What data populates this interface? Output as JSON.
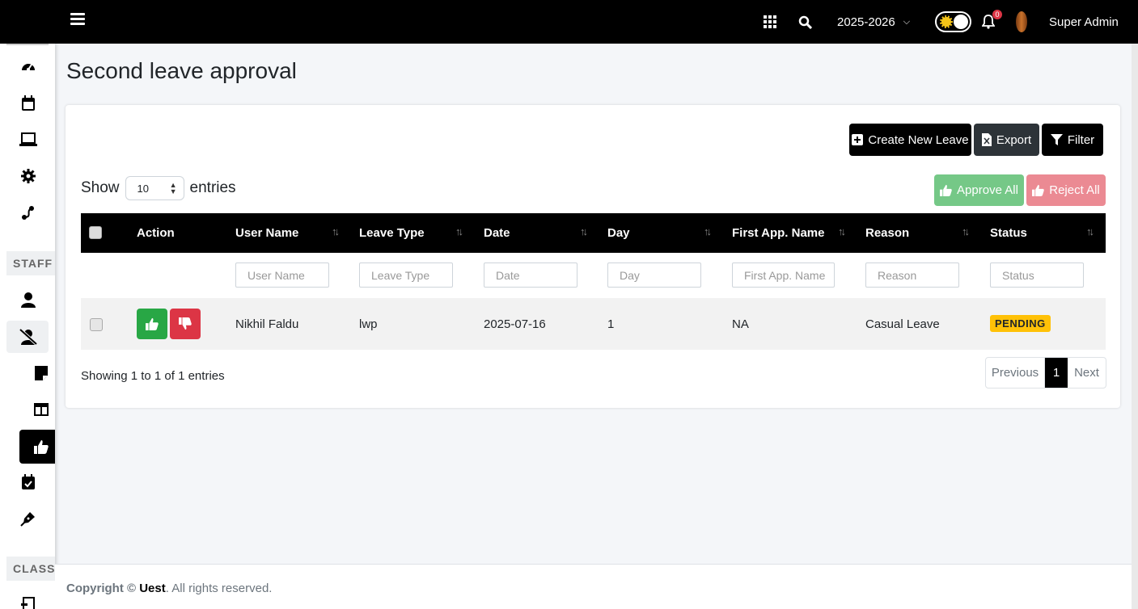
{
  "topbar": {
    "academic_year": "2025-2026",
    "notification_count": "0",
    "user_name": "Super Admin"
  },
  "sidebar": {
    "sections": [
      "STAFF",
      "CLASSWORK"
    ]
  },
  "page": {
    "title": "Second leave approval"
  },
  "toolbar": {
    "create_label": "Create New Leave",
    "export_label": "Export",
    "filter_label": "Filter",
    "approve_all_label": "Approve All",
    "reject_all_label": "Reject All"
  },
  "length": {
    "show": "Show",
    "value": "10",
    "entries": "entries"
  },
  "table": {
    "columns": [
      "Action",
      "User Name",
      "Leave Type",
      "Date",
      "Day",
      "First App. Name",
      "Reason",
      "Status"
    ],
    "filters": [
      "User Name",
      "Leave Type",
      "Date",
      "Day",
      "First App. Name",
      "Reason",
      "Status"
    ],
    "rows": [
      {
        "user_name": "Nikhil Faldu",
        "leave_type": "lwp",
        "date": "2025-07-16",
        "day": "1",
        "first_app_name": "NA",
        "reason": "Casual Leave",
        "status": "PENDING"
      }
    ]
  },
  "info": "Showing 1 to 1 of 1 entries",
  "pagination": {
    "previous": "Previous",
    "current": "1",
    "next": "Next"
  },
  "footer": {
    "prefix": "Copyright ©",
    "brand": "Uest",
    "suffix": ". All rights reserved."
  },
  "colors": {
    "approve": "#28a745",
    "reject": "#dc3545",
    "pending": "#ffc107",
    "header": "#000000"
  }
}
